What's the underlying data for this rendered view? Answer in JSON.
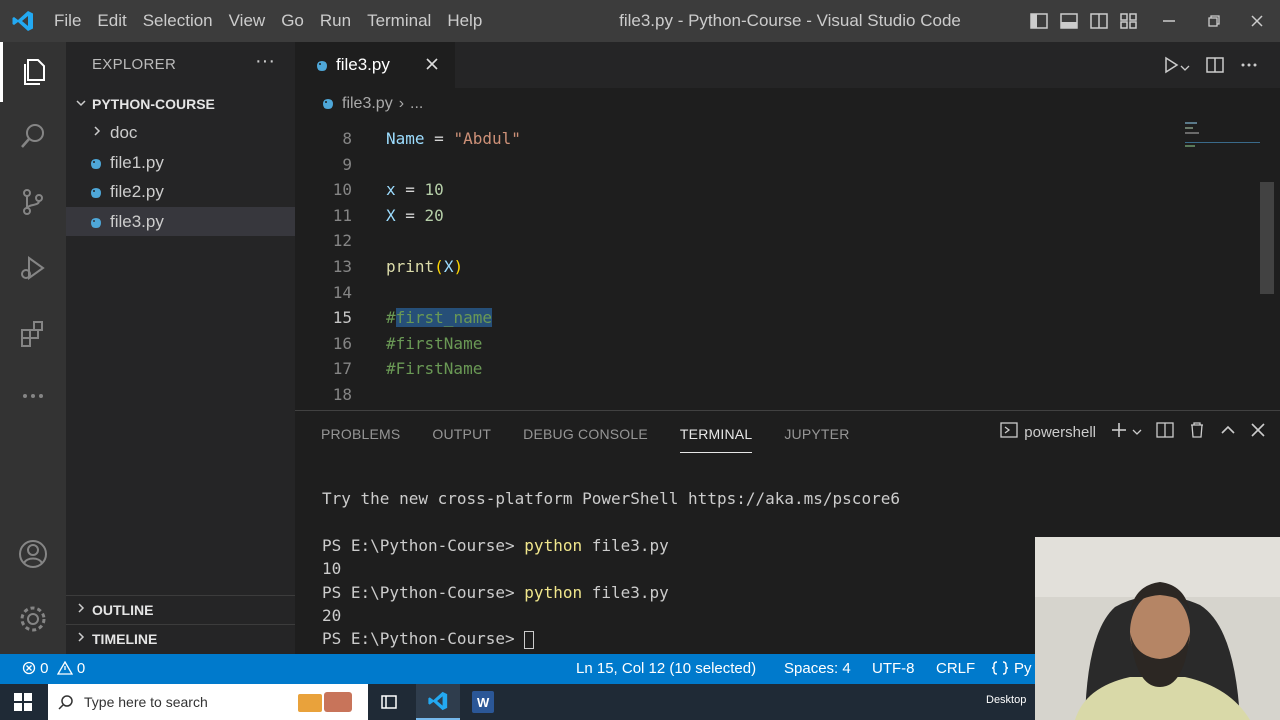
{
  "window": {
    "title": "file3.py - Python-Course - Visual Studio Code",
    "menu": [
      "File",
      "Edit",
      "Selection",
      "View",
      "Go",
      "Run",
      "Terminal",
      "Help"
    ]
  },
  "sidebar": {
    "header": "EXPLORER",
    "more": "···",
    "folder": "PYTHON-COURSE",
    "items": [
      {
        "label": "doc",
        "type": "folder"
      },
      {
        "label": "file1.py",
        "type": "python"
      },
      {
        "label": "file2.py",
        "type": "python"
      },
      {
        "label": "file3.py",
        "type": "python",
        "selected": true
      }
    ],
    "sections": [
      "OUTLINE",
      "TIMELINE"
    ]
  },
  "editor": {
    "tab_label": "file3.py",
    "breadcrumb_file": "file3.py",
    "breadcrumb_sep": "›",
    "breadcrumb_more": "...",
    "lines": [
      {
        "n": "8"
      },
      {
        "n": "9"
      },
      {
        "n": "10"
      },
      {
        "n": "11"
      },
      {
        "n": "12"
      },
      {
        "n": "13"
      },
      {
        "n": "14"
      },
      {
        "n": "15"
      },
      {
        "n": "16"
      },
      {
        "n": "17"
      },
      {
        "n": "18"
      }
    ],
    "code": {
      "l8_var": "Name",
      "l8_op": " = ",
      "l8_str": "\"Abdul\"",
      "l10_var": "x",
      "l10_op": " = ",
      "l10_num": "10",
      "l11_var": "X",
      "l11_op": " = ",
      "l11_num": "20",
      "l13_fn": "print",
      "l13_open": "(",
      "l13_arg": "X",
      "l13_close": ")",
      "l15_hash": "#",
      "l15_sel": "first_name",
      "l16": "#firstName",
      "l17": "#FirstName"
    }
  },
  "panel": {
    "tabs": [
      "PROBLEMS",
      "OUTPUT",
      "DEBUG CONSOLE",
      "TERMINAL",
      "JUPYTER"
    ],
    "active_tab": "TERMINAL",
    "shell": "powershell",
    "terminal": {
      "notice": "Try the new cross-platform PowerShell https://aka.ms/pscore6",
      "prompt": "PS E:\\Python-Course> ",
      "cmd1": "python",
      "arg1": " file3.py",
      "out1": "10",
      "cmd2": "python",
      "arg2": " file3.py",
      "out2": "20"
    }
  },
  "status": {
    "errors": "0",
    "warnings": "0",
    "position": "Ln 15, Col 12 (10 selected)",
    "spaces": "Spaces: 4",
    "encoding": "UTF-8",
    "eol": "CRLF",
    "lang": "Py"
  },
  "taskbar": {
    "search_placeholder": "Type here to search",
    "desktop_label": "Desktop"
  },
  "colors": {
    "accent": "#007acc",
    "titlebar": "#3c3c3c",
    "activitybar": "#333333",
    "sidebar": "#252526",
    "editor": "#1e1e1e"
  }
}
